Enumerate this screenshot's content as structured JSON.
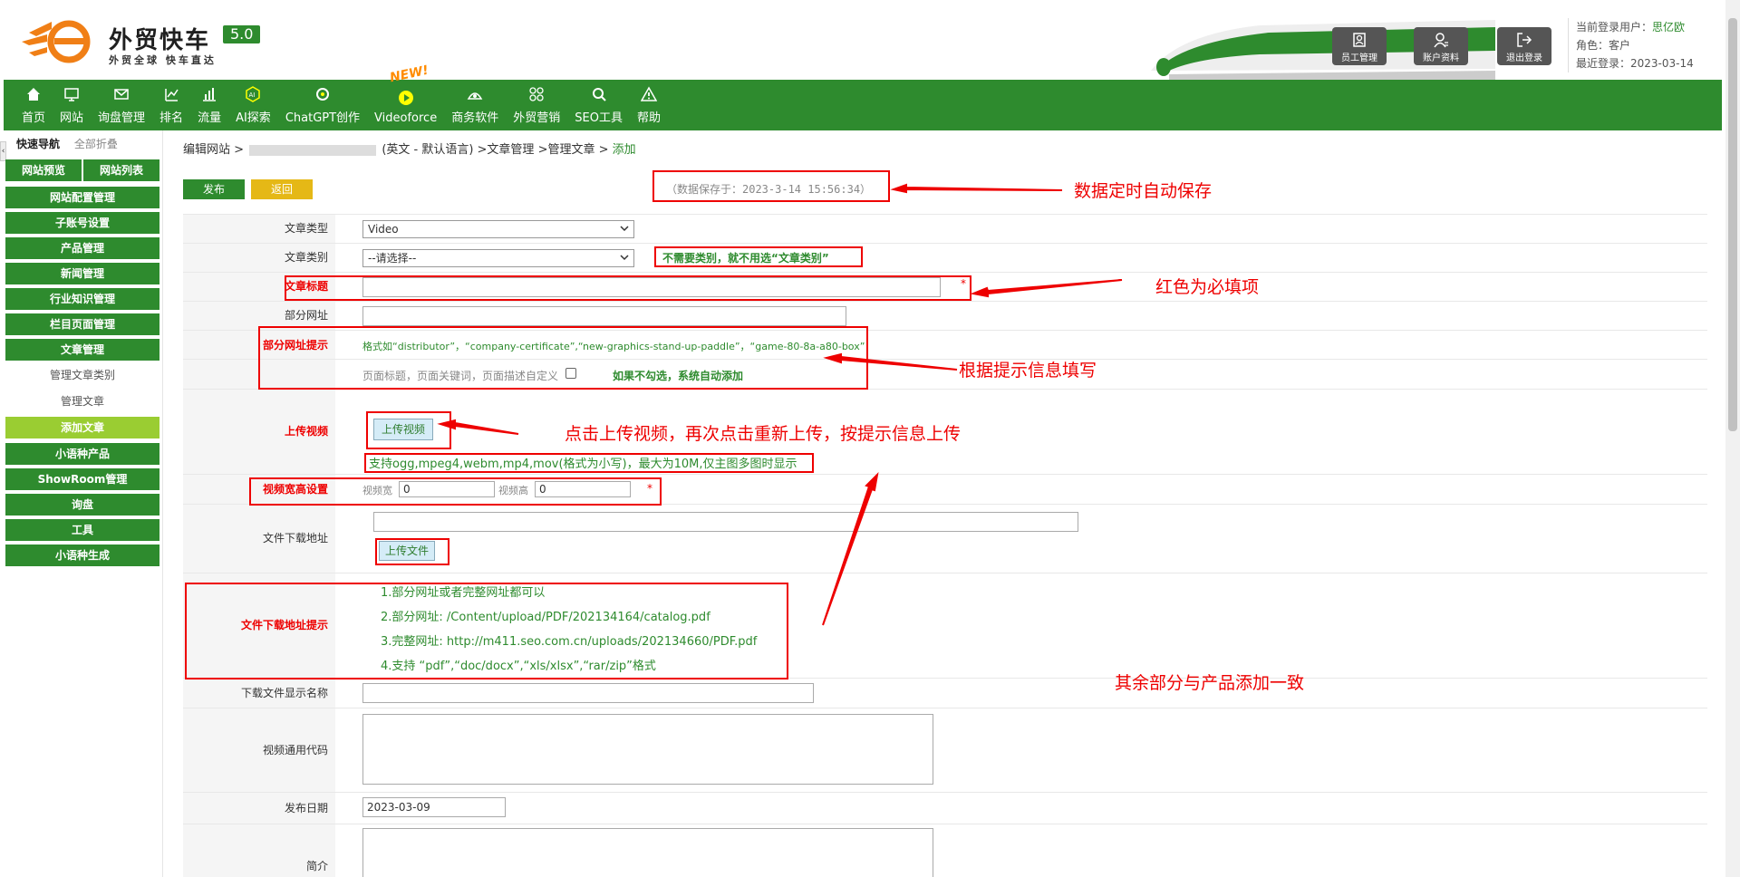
{
  "header": {
    "logo_title": "外贸快车",
    "logo_version": "5.0",
    "logo_subtitle": "外贸全球 快车直达",
    "buttons": [
      {
        "label": "员工管理",
        "icon": "staff-icon"
      },
      {
        "label": "账户资料",
        "icon": "account-icon"
      },
      {
        "label": "退出登录",
        "icon": "logout-icon"
      }
    ],
    "user": {
      "login_label": "当前登录用户：",
      "login_name": "思亿欧",
      "role": "角色：客户",
      "last_login": "最近登录：2023-03-14"
    }
  },
  "nav": {
    "items": [
      {
        "label": "首页",
        "icon": "home-icon"
      },
      {
        "label": "网站",
        "icon": "monitor-icon"
      },
      {
        "label": "询盘管理",
        "icon": "mail-icon"
      },
      {
        "label": "排名",
        "icon": "ranking-icon"
      },
      {
        "label": "流量",
        "icon": "bar-chart-icon"
      },
      {
        "label": "AI探索",
        "icon": "ai-icon"
      },
      {
        "label": "ChatGPT创作",
        "icon": "chatgpt-icon"
      },
      {
        "label": "Videoforce",
        "icon": "video-icon"
      },
      {
        "label": "商务软件",
        "icon": "software-icon"
      },
      {
        "label": "外贸营销",
        "icon": "marketing-icon"
      },
      {
        "label": "SEO工具",
        "icon": "search-icon"
      },
      {
        "label": "帮助",
        "icon": "help-icon"
      }
    ],
    "new_badge": "NEW!"
  },
  "sidebar": {
    "quick_nav": "快速导航",
    "fold_all": "全部折叠",
    "top_buttons": [
      "网站预览",
      "网站列表"
    ],
    "items": [
      "网站配置管理",
      "子账号设置",
      "产品管理",
      "新闻管理",
      "行业知识管理",
      "栏目页面管理",
      "文章管理"
    ],
    "sub_items": [
      "管理文章类别",
      "管理文章",
      "添加文章"
    ],
    "items_after": [
      "小语种产品",
      "ShowRoom管理",
      "询盘",
      "工具",
      "小语种生成"
    ]
  },
  "main": {
    "breadcrumb": {
      "prefix": "编辑网站 >",
      "middle": "(英文 - 默认语言) >文章管理 >管理文章 >",
      "current": "添加"
    },
    "publish_label": "发布",
    "back_label": "返回",
    "autosave": "（数据保存于：2023-3-14 15:56:34）",
    "form": {
      "article_type_label": "文章类型",
      "article_type_value": "Video",
      "article_category_label": "文章类别",
      "article_category_value": "--请选择--",
      "article_title_label": "文章标题",
      "partial_url_label": "部分网址",
      "partial_url_hint_label": "部分网址提示",
      "partial_url_hint": "格式如“distributor”，“company-certificate”,“new-graphics-stand-up-paddle”，“game-80-8a-a80-box”",
      "seo_custom_label": "页面标题，页面关键词，页面描述自定义",
      "upload_video_label": "上传视频",
      "upload_video_button": "上传视频",
      "upload_video_hint": "支持ogg,mpeg4,webm,mp4,mov(格式为小写)，最大为10M,仅主图多图时显示",
      "video_size_label": "视频宽高设置",
      "video_width_label": "视频宽",
      "video_width_value": "0",
      "video_height_label": "视频高",
      "video_height_value": "0",
      "file_url_label": "文件下载地址",
      "upload_file_button": "上传文件",
      "file_hint_label": "文件下载地址提示",
      "file_hints": [
        "1.部分网址或者完整网址都可以",
        "2.部分网址: /Content/upload/PDF/202134164/catalog.pdf",
        "3.完整网址: http://m411.seo.com.cn/uploads/202134660/PDF.pdf",
        "4.支持 “pdf”,“doc/docx”,“xls/xlsx”,“rar/zip”格式"
      ],
      "download_name_label": "下载文件显示名称",
      "video_code_label": "视频通用代码",
      "publish_date_label": "发布日期",
      "publish_date_value": "2023-03-09",
      "summary_label": "简介",
      "required_star": "*"
    }
  },
  "annotations": {
    "autosave": "数据定时自动保存",
    "no_category": "不需要类别，就不用选“文章类别”",
    "required": "红色为必填项",
    "fill_hint": "根据提示信息填写",
    "auto_add": "如果不勾选，系统自动添加",
    "upload_video": "点击上传视频，再次点击重新上传，按提示信息上传",
    "rest_same": "其余部分与产品添加一致"
  },
  "colors": {
    "brand_green": "#2e8b2e",
    "annotation_red": "#e00000",
    "active_item": "#9acd32",
    "back_button": "#e5b816"
  }
}
